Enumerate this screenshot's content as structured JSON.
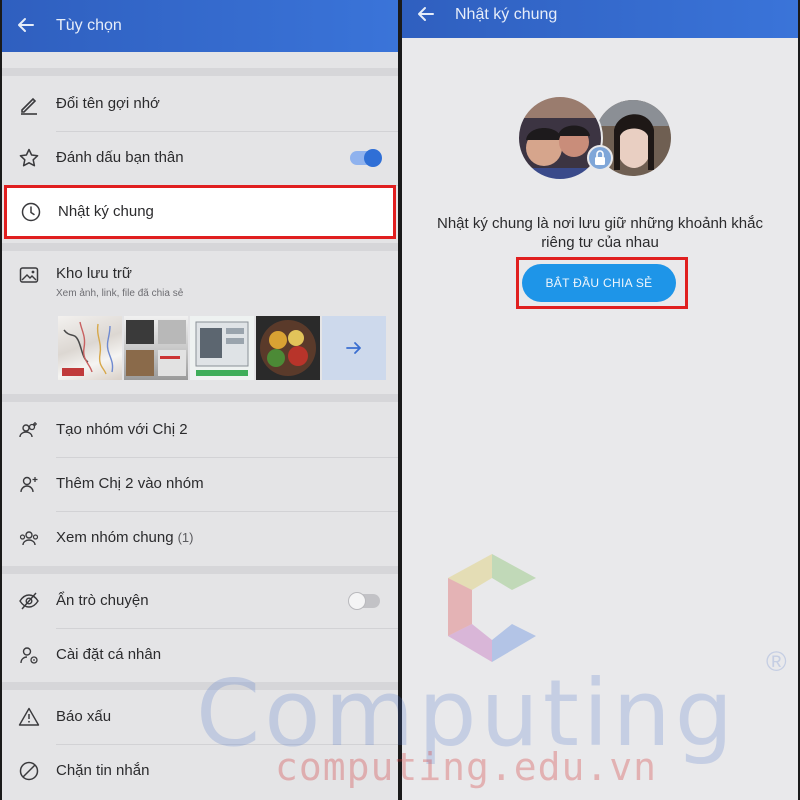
{
  "left_screen": {
    "header_title": "Tùy chọn",
    "items": {
      "rename": "Đổi tên gợi nhớ",
      "best_friend": "Đánh dấu bạn thân",
      "diary": "Nhật ký chung",
      "storage": "Kho lưu trữ",
      "storage_sub": "Xem ảnh, link, file đã chia sẻ",
      "create_group": "Tạo nhóm với Chị 2",
      "add_to_group": "Thêm Chị 2  vào nhóm",
      "common_groups": "Xem nhóm chung",
      "common_groups_count": "(1)",
      "hide_chat": "Ẩn trò chuyện",
      "personal_settings": "Cài đặt cá nhân",
      "report": "Báo xấu",
      "block": "Chặn tin nhắn"
    },
    "toggles": {
      "best_friend_on": true,
      "hide_chat_on": false
    }
  },
  "right_screen": {
    "header_title": "Nhật ký chung",
    "description_line1": "Nhật ký chung là nơi lưu giữ những khoảnh khắc",
    "description_line2": "riêng tư của nhau",
    "start_button": "BẮT ĐẦU CHIA SẺ"
  },
  "watermark": {
    "brand": "Computing",
    "url": "computing.edu.vn",
    "reg": "®"
  },
  "colors": {
    "header": "#3a74d9",
    "highlight": "#e01f1f",
    "button": "#1e95e8",
    "toggle_on": "#2f6fd6"
  }
}
